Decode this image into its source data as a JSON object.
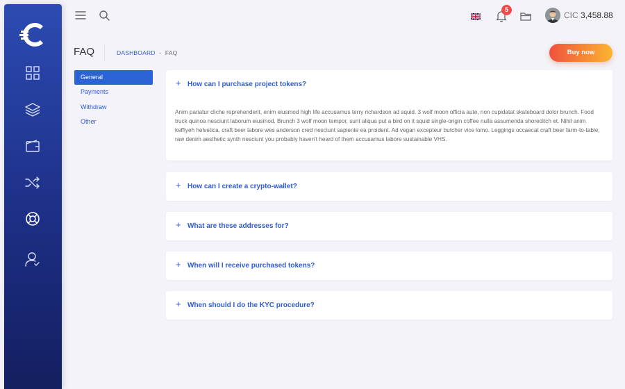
{
  "sidebar": {
    "items": [
      {
        "name": "dashboard-grid-icon"
      },
      {
        "name": "layers-icon"
      },
      {
        "name": "wallet-icon"
      },
      {
        "name": "shuffle-icon"
      },
      {
        "name": "lifebuoy-icon"
      },
      {
        "name": "user-icon"
      }
    ]
  },
  "header": {
    "notifications_count": "5",
    "balance_currency": "CIC",
    "balance_amount": "3,458.88"
  },
  "page": {
    "title": "FAQ",
    "breadcrumb_link": "DASHBOARD",
    "breadcrumb_sep": "-",
    "breadcrumb_current": "FAQ",
    "buy_label": "Buy now"
  },
  "categories": [
    {
      "label": "General",
      "active": true
    },
    {
      "label": "Payments",
      "active": false
    },
    {
      "label": "Withdraw",
      "active": false
    },
    {
      "label": "Other",
      "active": false
    }
  ],
  "faq": [
    {
      "question": "How can I purchase project tokens?",
      "expanded": true,
      "answer": "Anim pariatur cliche reprehenderit, enim eiusmod high life accusamus terry richardson ad squid. 3 wolf moon officia aute, non cupidatat skateboard dolor brunch. Food truck quinoa nesciunt laborum eiusmod. Brunch 3 wolf moon tempor, sunt aliqua put a bird on it squid single-origin coffee nulla assumenda shoreditch et. Nihil anim keffiyeh helvetica, craft beer labore wes anderson cred nesciunt sapiente ea proident. Ad vegan excepteur butcher vice lomo. Leggings occaecat craft beer farm-to-table, raw denim aesthetic synth nesciunt you probably haven't heard of them accusamus labore sustainable VHS."
    },
    {
      "question": "How can I create a crypto-wallet?",
      "expanded": false
    },
    {
      "question": "What are these addresses for?",
      "expanded": false
    },
    {
      "question": "When will I receive purchased tokens?",
      "expanded": false
    },
    {
      "question": "When should I do the KYC procedure?",
      "expanded": false
    }
  ],
  "colors": {
    "accent": "#2f5bd3",
    "sidebar_top": "#2c4bb2",
    "sidebar_bottom": "#141f5f",
    "buy_gradient_start": "#f0513e",
    "buy_gradient_end": "#fbb530",
    "badge": "#f04b4b"
  }
}
